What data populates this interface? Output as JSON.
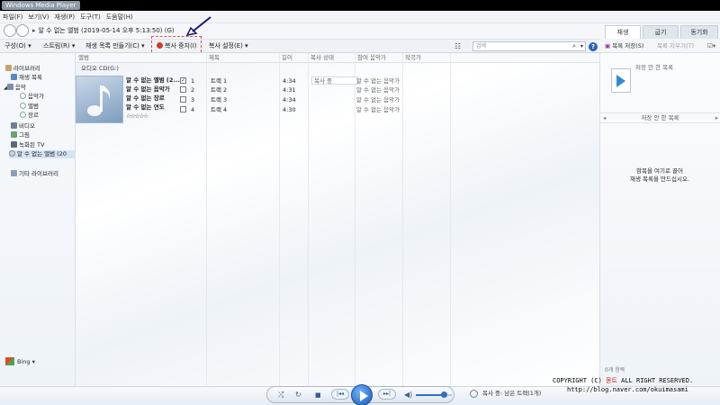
{
  "window": {
    "title": "Windows Media Player"
  },
  "menu": [
    "파일(F)",
    "보기(V)",
    "재생(P)",
    "도구(T)",
    "도움말(H)"
  ],
  "nav": {
    "breadcrumb": "알 수 없는 앨범 (2019-05-14 오후 5:13:50) (G)"
  },
  "right_tabs": [
    "재생",
    "굽기",
    "동기화"
  ],
  "toolbar": {
    "organize": "구성(O)",
    "stream": "스트림(R)",
    "create_playlist": "재생 목록 만들기(C)",
    "stop_rip": "복사 중지(I)",
    "rip_settings": "복사 설정(E)",
    "search_placeholder": "검색"
  },
  "right_toolbar": {
    "save_list": "목록 저장(S)",
    "clear_list": "목록 지우기(T)"
  },
  "nav_pane": {
    "library": "라이브러리",
    "playlists": "재생 목록",
    "music": "음악",
    "artist": "음악가",
    "album": "앨범",
    "genre": "장르",
    "videos": "비디오",
    "pictures": "그림",
    "recorded_tv": "녹화된 TV",
    "cd": "알 수 없는 앨범 (20",
    "other_libraries": "기타 라이브러리"
  },
  "columns": {
    "album": "앨범",
    "title": "제목",
    "length": "길이",
    "rip_status": "복사 상태",
    "contributing_artist": "참여 음악가",
    "composer": "작곡가"
  },
  "group": {
    "name": "오디오 CD(G:)"
  },
  "album_info": {
    "album": "알 수 없는 앨범 (2...",
    "artist": "알 수 없는 음악가",
    "genre": "알 수 없는 장르",
    "year": "알 수 없는 연도",
    "rating": "☆☆☆☆☆"
  },
  "tracks": [
    {
      "checked": "✓",
      "num": "1",
      "title": "트랙 1",
      "length": "4:34",
      "status": "복사 중",
      "artist": "알 수 없는 음악가"
    },
    {
      "checked": "",
      "num": "2",
      "title": "트랙 2",
      "length": "4:31",
      "status": "",
      "artist": "알 수 없는 음악가"
    },
    {
      "checked": "",
      "num": "3",
      "title": "트랙 3",
      "length": "4:34",
      "status": "",
      "artist": "알 수 없는 음악가"
    },
    {
      "checked": "",
      "num": "4",
      "title": "트랙 4",
      "length": "4:30",
      "status": "",
      "artist": "알 수 없는 음악가"
    }
  ],
  "right_pane": {
    "unsaved_top": "저장 안 한 목록",
    "unsaved_bar": "저장 안 한 목록",
    "empty_line1": "항목을 여기로 끌어",
    "empty_line2": "재생 목록을 만드십시오.",
    "item_count": "0개 항목"
  },
  "bing": {
    "label": "Bing"
  },
  "status": {
    "text": "복사 중: 남은 트랙(1개)"
  },
  "watermark": {
    "line1_a": "COPYRIGHT (C) ",
    "line1_red": "몽트",
    "line1_b": " ALL RIGHT RESERVED.",
    "line2": "http://blog.naver.com/okuimasami"
  },
  "colors": {
    "accent": "#2f6fc2",
    "rip_red": "#d23a2a",
    "titlebar": "#000000"
  }
}
